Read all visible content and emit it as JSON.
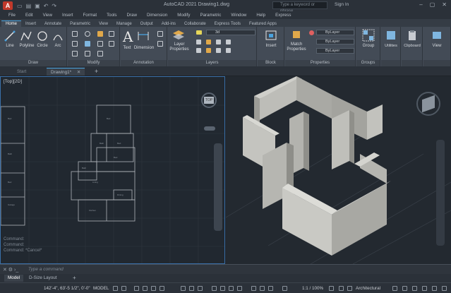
{
  "app": {
    "title": "AutoCAD 2021   Drawing1.dwg",
    "logo": "A",
    "search_placeholder": "Type a keyword or phrase",
    "signin": "Sign In"
  },
  "menubar": [
    "File",
    "Edit",
    "View",
    "Insert",
    "Format",
    "Tools",
    "Draw",
    "Dimension",
    "Modify",
    "Parametric",
    "Window",
    "Help",
    "Express"
  ],
  "ribbon_tabs": [
    {
      "label": "Home",
      "active": true
    },
    {
      "label": "Insert"
    },
    {
      "label": "Annotate"
    },
    {
      "label": "Parametric"
    },
    {
      "label": "View"
    },
    {
      "label": "Manage"
    },
    {
      "label": "Output"
    },
    {
      "label": "Add-ins"
    },
    {
      "label": "Collaborate"
    },
    {
      "label": "Express Tools"
    },
    {
      "label": "Featured Apps"
    }
  ],
  "ribbon": {
    "draw": {
      "title": "Draw",
      "line": "Line",
      "polyline": "Polyline",
      "circle": "Circle",
      "arc": "Arc"
    },
    "modify": {
      "title": "Modify"
    },
    "annotation": {
      "title": "Annotation",
      "text": "Text",
      "dimension": "Dimension"
    },
    "layers": {
      "title": "Layers",
      "layer_properties": "Layer Properties",
      "layer_value": "3d"
    },
    "block": {
      "title": "Block",
      "insert": "Insert"
    },
    "properties": {
      "title": "Properties",
      "match": "Match Properties",
      "bylayer1": "ByLayer",
      "bylayer2": "ByLayer",
      "bylayer3": "ByLayer"
    },
    "groups": {
      "title": "Groups",
      "group": "Group"
    },
    "utilities": "Utilities",
    "clipboard": "Clipboard",
    "view": "View"
  },
  "file_tabs": {
    "start": "Start",
    "drawing": "Drawing1*"
  },
  "viewport2d": {
    "label": "[Top][2D]",
    "compass": "TOP"
  },
  "viewport3d": {
    "label": ""
  },
  "history": [
    "Command:",
    "Command:",
    "Command: *Cancel*"
  ],
  "cmdline": {
    "placeholder": "Type a command"
  },
  "layout_tabs": {
    "model": "Model",
    "layout": "D-Size Layout"
  },
  "status": {
    "coords": "142'-4\", 63'-5 1/2\", 0'-0\"",
    "model": "MODEL",
    "scale": "1:1 / 100%",
    "units": "Architectural"
  },
  "colors": {
    "accent": "#4aa3df",
    "bg": "#1e2329",
    "ribbon": "#434b56",
    "walls": "#b9b9b4"
  }
}
